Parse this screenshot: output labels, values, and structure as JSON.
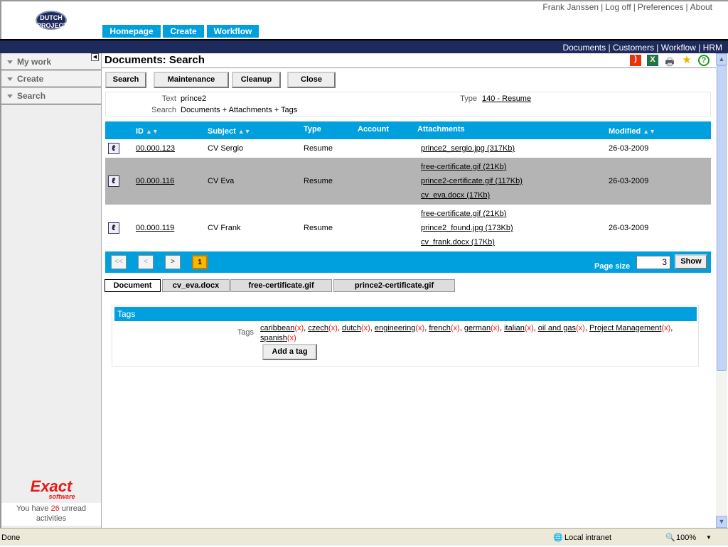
{
  "header": {
    "logo": "DUTCH PROJECTS",
    "tabs": [
      "Homepage",
      "Create",
      "Workflow"
    ],
    "user": "Frank Janssen",
    "links": [
      "Log off",
      "Preferences",
      "About"
    ],
    "nav": [
      "Documents",
      "Customers",
      "Workflow",
      "HRM"
    ]
  },
  "sidebar": {
    "items": [
      "My work",
      "Create",
      "Search"
    ],
    "logo": "Exact",
    "logo_sub": "software",
    "unread_pre": "You have",
    "unread_count": "26",
    "unread_post": "unread activities"
  },
  "page": {
    "title": "Documents: Search",
    "toolbar_icons": [
      "rss-icon",
      "excel-icon",
      "print-icon",
      "favorite-icon",
      "help-icon"
    ],
    "buttons": [
      "Search",
      "Maintenance",
      "Cleanup",
      "Close"
    ],
    "criteria": {
      "text_label": "Text",
      "text_value": "prince2",
      "search_label": "Search",
      "search_value": "Documents + Attachments + Tags",
      "type_label": "Type",
      "type_value": "140 - Resume"
    }
  },
  "table": {
    "columns": [
      "ID",
      "Subject",
      "Type",
      "Account",
      "Attachments",
      "Modified"
    ],
    "rows": [
      {
        "id": "00.000.123",
        "subject": "CV Sergio",
        "type": "Resume",
        "account": "",
        "attachments": [
          "prince2_sergio.jpg (317Kb)"
        ],
        "modified": "26-03-2009"
      },
      {
        "id": "00.000.116",
        "subject": "CV Eva",
        "type": "Resume",
        "account": "",
        "attachments": [
          "free-certificate.gif (21Kb)",
          "prince2-certificate.gif (117Kb)",
          "cv_eva.docx (17Kb)"
        ],
        "modified": "26-03-2009"
      },
      {
        "id": "00.000.119",
        "subject": "CV Frank",
        "type": "Resume",
        "account": "",
        "attachments": [
          "free-certificate.gif (21Kb)",
          "prince2_found.jpg (173Kb)",
          "cv_frank.docx (17Kb)"
        ],
        "modified": "26-03-2009"
      }
    ],
    "pager": {
      "first": "<<",
      "prev": "<",
      "next": ">",
      "current": "1",
      "page_size_label": "Page size",
      "page_size": "3",
      "show": "Show"
    }
  },
  "tabs": [
    "Document",
    "cv_eva.docx",
    "free-certificate.gif",
    "prince2-certificate.gif"
  ],
  "tags": {
    "title": "Tags",
    "label": "Tags",
    "items": [
      "caribbean",
      "czech",
      "dutch",
      "engineering",
      "french",
      "german",
      "italian",
      "oil and gas",
      "Project Management",
      "spanish"
    ],
    "remove": "(x)",
    "add": "Add a tag"
  },
  "status": {
    "text": "Done",
    "zone": "Local intranet",
    "zoom": "100%"
  }
}
